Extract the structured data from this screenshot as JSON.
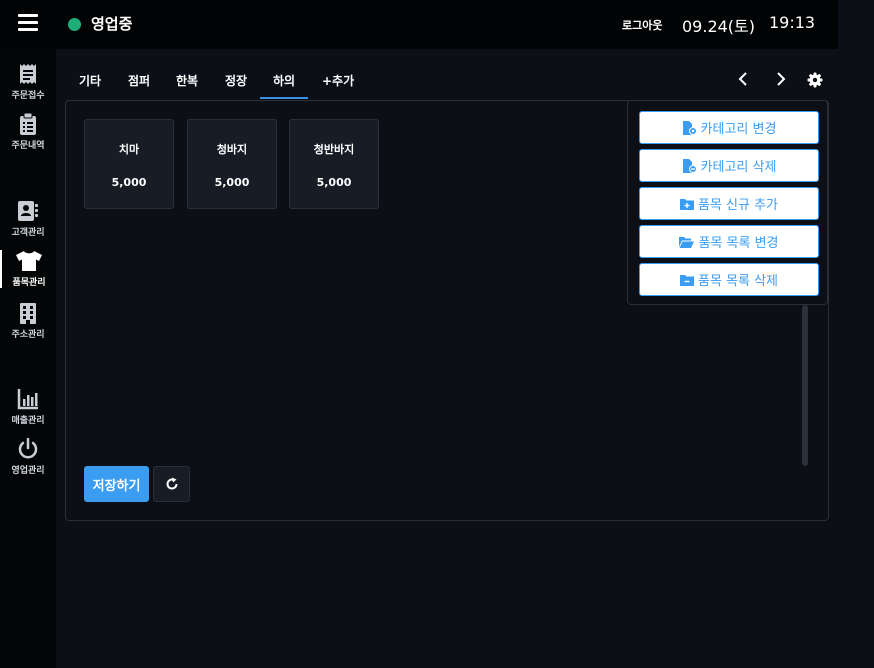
{
  "header": {
    "status_label": "영업중",
    "logout_label": "로그아웃",
    "date": "09.24(토)",
    "time": "19:13"
  },
  "sidebar": {
    "items": [
      {
        "label": "주문접수",
        "icon": "receipt-icon"
      },
      {
        "label": "주문내역",
        "icon": "clipboard-icon"
      },
      {
        "label": "고객관리",
        "icon": "contact-book-icon"
      },
      {
        "label": "품목관리",
        "icon": "shirt-icon",
        "active": true
      },
      {
        "label": "주소관리",
        "icon": "building-icon"
      },
      {
        "label": "매출관리",
        "icon": "bar-chart-icon"
      },
      {
        "label": "영업관리",
        "icon": "power-icon"
      }
    ]
  },
  "tabs": [
    {
      "label": "기타"
    },
    {
      "label": "점퍼"
    },
    {
      "label": "한복"
    },
    {
      "label": "정장"
    },
    {
      "label": "하의",
      "active": true
    },
    {
      "label": "+추가"
    }
  ],
  "items": [
    {
      "name": "치마",
      "price": "5,000"
    },
    {
      "name": "청바지",
      "price": "5,000"
    },
    {
      "name": "청반바지",
      "price": "5,000"
    }
  ],
  "actions": {
    "save_label": "저장하기"
  },
  "menu": [
    {
      "label": "카테고리 변경",
      "icon": "file-gear-icon"
    },
    {
      "label": "카테고리 삭제",
      "icon": "file-minus-icon"
    },
    {
      "label": "품목 신규 추가",
      "icon": "folder-plus-icon"
    },
    {
      "label": "품목 목록 변경",
      "icon": "folder-open-icon"
    },
    {
      "label": "품목 목록 삭제",
      "icon": "folder-minus-icon"
    }
  ],
  "colors": {
    "accent": "#3b9df2",
    "status_green": "#1fae78",
    "background": "#0c0f16"
  }
}
